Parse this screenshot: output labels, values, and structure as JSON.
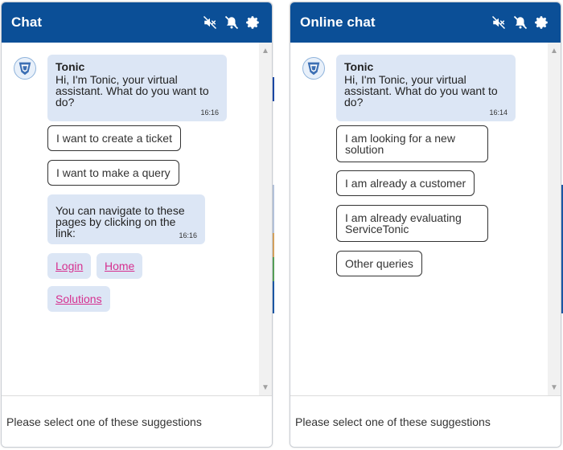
{
  "left_chat": {
    "title": "Chat",
    "bot_name": "Tonic",
    "greeting": "Hi, I'm Tonic, your virtual assistant. What do you want to do?",
    "greeting_time": "16:16",
    "options": [
      "I want to create a ticket",
      "I want to make a query"
    ],
    "nav_message": "You can navigate to these pages by clicking on the link:",
    "nav_time": "16:16",
    "links": [
      "Login",
      "Home",
      "Solutions"
    ],
    "input_placeholder": "Please select one of these suggestions"
  },
  "right_chat": {
    "title": "Online chat",
    "bot_name": "Tonic",
    "greeting": "Hi, I'm Tonic, your virtual assistant. What do you want to do?",
    "greeting_time": "16:14",
    "options": [
      "I am looking for a new solution",
      "I am already a customer",
      "I am already evaluating ServiceTonic",
      "Other queries"
    ],
    "input_placeholder": "Please select one of these suggestions"
  },
  "icons": [
    "mute-sound-icon",
    "mute-notification-icon",
    "gear-icon",
    "bot-avatar-icon"
  ],
  "colors": {
    "header": "#0b4f97",
    "bubble": "#dce6f5",
    "link": "#d6308f"
  }
}
